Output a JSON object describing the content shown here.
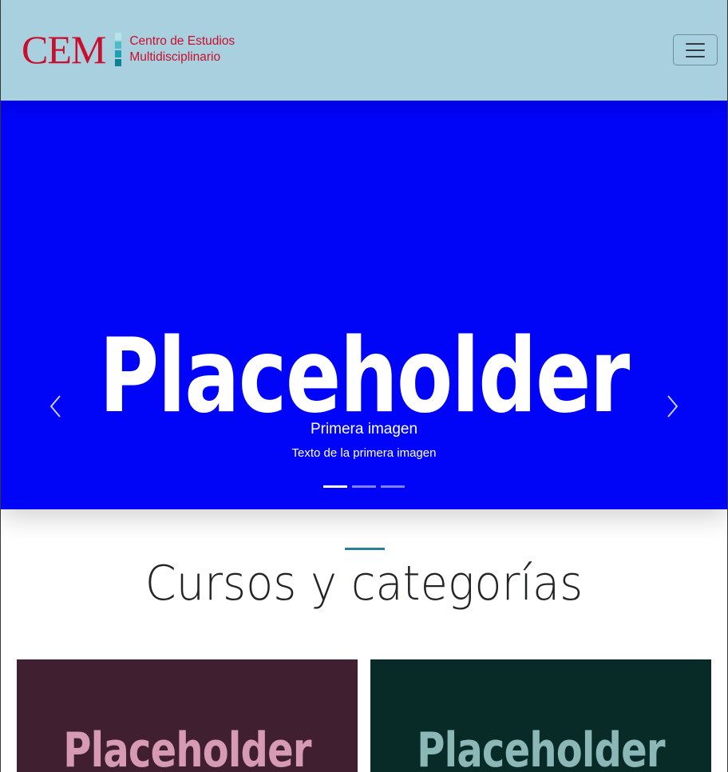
{
  "navbar": {
    "brand_short": "CEM",
    "brand_line1": "Centro de Estudios",
    "brand_line2": "Multidisciplinario",
    "toggler_icon": "hamburger-menu-icon",
    "colors": {
      "background": "#a9d0df",
      "brand": "#c8102e"
    }
  },
  "carousel": {
    "placeholder_text": "Placeholder",
    "background": "#0004f7",
    "caption_title": "Primera imagen",
    "caption_text": "Texto de la primera imagen",
    "prev_icon": "chevron-left-icon",
    "next_icon": "chevron-right-icon",
    "slides_count": 3,
    "active_slide": 1
  },
  "section": {
    "title": "Cursos y categorías",
    "accent": "#2a7f93"
  },
  "cards": [
    {
      "placeholder_text": "Placeholder",
      "background": "#3f1f30",
      "text_color": "#d69bb2"
    },
    {
      "placeholder_text": "Placeholder",
      "background": "#082b27",
      "text_color": "#8bb8b7"
    }
  ]
}
